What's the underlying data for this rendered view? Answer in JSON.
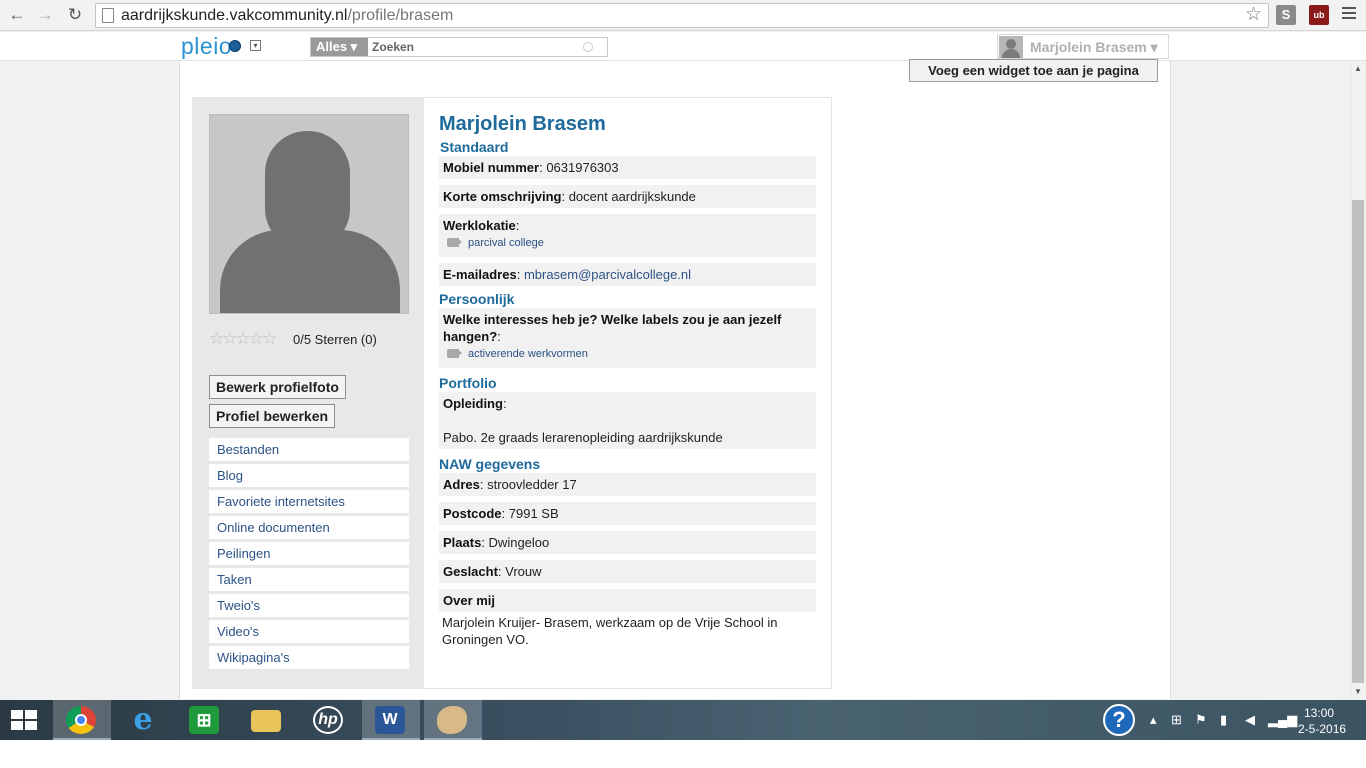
{
  "browser": {
    "url_host": "aardrijkskunde.vakcommunity.nl",
    "url_path": "/profile/brasem",
    "ext_s": "S",
    "ext_ub": "ub"
  },
  "topbar": {
    "logo": "pleio",
    "search_scope": "Alles ▾",
    "search_placeholder": "Zoeken",
    "user_name": "Marjolein Brasem ▾"
  },
  "widget_button": "Voeg een widget toe aan je pagina",
  "profile": {
    "name": "Marjolein Brasem",
    "rating_text": "0/5 Sterren (0)",
    "stars": "☆☆☆☆☆",
    "edit_photo": "Bewerk profielfoto",
    "edit_profile": "Profiel bewerken",
    "menu": [
      "Bestanden",
      "Blog",
      "Favoriete internetsites",
      "Online documenten",
      "Peilingen",
      "Taken",
      "Tweio's",
      "Video's",
      "Wikipagina's"
    ],
    "standaard": {
      "title": "Standaard",
      "mobile_label": "Mobiel nummer",
      "mobile_value": "0631976303",
      "desc_label": "Korte omschrijving",
      "desc_value": "docent aardrijkskunde",
      "work_label": "Werklokatie",
      "work_tag": "parcival college",
      "email_label": "E-mailadres",
      "email_value": "mbrasem@parcivalcollege.nl"
    },
    "persoonlijk": {
      "title": "Persoonlijk",
      "interests_label": "Welke interesses heb je? Welke labels zou je aan jezelf hangen?",
      "interests_tag": "activerende werkvormen"
    },
    "portfolio": {
      "title": "Portfolio",
      "edu_label": "Opleiding",
      "edu_value": "Pabo. 2e graads lerarenopleiding aardrijkskunde"
    },
    "naw": {
      "title": "NAW gegevens",
      "address_label": "Adres",
      "address_value": "stroovledder 17",
      "postcode_label": "Postcode",
      "postcode_value": "7991 SB",
      "city_label": "Plaats",
      "city_value": "Dwingeloo",
      "gender_label": "Geslacht",
      "gender_value": "Vrouw",
      "about_label": "Over mij",
      "about_value": "Marjolein Kruijer- Brasem, werkzaam op de Vrije School in Groningen VO."
    }
  },
  "taskbar": {
    "time": "13:00",
    "date": "2-5-2016",
    "help": "?"
  }
}
